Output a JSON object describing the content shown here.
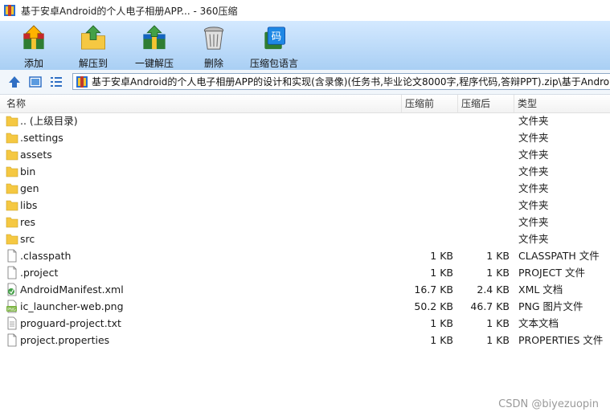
{
  "window": {
    "title": "基于安卓Android的个人电子相册APP... - 360压缩"
  },
  "toolbar": {
    "items": [
      {
        "label": "添加",
        "icon": "add-archive-icon"
      },
      {
        "label": "解压到",
        "icon": "extract-to-icon"
      },
      {
        "label": "一键解压",
        "icon": "one-click-extract-icon"
      },
      {
        "label": "删除",
        "icon": "trash-icon"
      },
      {
        "label": "压缩包语言",
        "icon": "archive-language-icon"
      }
    ]
  },
  "nav": {
    "buttons": [
      "up-arrow-icon",
      "thumbnail-view-icon",
      "list-view-icon"
    ],
    "path": "基于安卓Android的个人电子相册APP的设计和实现(含录像)(任务书,毕业论文8000字,程序代码,答辩PPT).zip\\基于Android的个人电子相册APP的设计和实现"
  },
  "columns": {
    "name": "名称",
    "size": "压缩前",
    "packed": "压缩后",
    "type": "类型"
  },
  "files": [
    {
      "name": ".. (上级目录)",
      "size": "",
      "packed": "",
      "type": "文件夹",
      "icon": "folder-icon"
    },
    {
      "name": ".settings",
      "size": "",
      "packed": "",
      "type": "文件夹",
      "icon": "folder-icon"
    },
    {
      "name": "assets",
      "size": "",
      "packed": "",
      "type": "文件夹",
      "icon": "folder-icon"
    },
    {
      "name": "bin",
      "size": "",
      "packed": "",
      "type": "文件夹",
      "icon": "folder-icon"
    },
    {
      "name": "gen",
      "size": "",
      "packed": "",
      "type": "文件夹",
      "icon": "folder-icon"
    },
    {
      "name": "libs",
      "size": "",
      "packed": "",
      "type": "文件夹",
      "icon": "folder-icon"
    },
    {
      "name": "res",
      "size": "",
      "packed": "",
      "type": "文件夹",
      "icon": "folder-icon"
    },
    {
      "name": "src",
      "size": "",
      "packed": "",
      "type": "文件夹",
      "icon": "folder-icon"
    },
    {
      "name": ".classpath",
      "size": "1 KB",
      "packed": "1 KB",
      "type": "CLASSPATH 文件",
      "icon": "blank-file-icon"
    },
    {
      "name": ".project",
      "size": "1 KB",
      "packed": "1 KB",
      "type": "PROJECT 文件",
      "icon": "blank-file-icon"
    },
    {
      "name": "AndroidManifest.xml",
      "size": "16.7 KB",
      "packed": "2.4 KB",
      "type": "XML 文档",
      "icon": "xml-file-icon"
    },
    {
      "name": "ic_launcher-web.png",
      "size": "50.2 KB",
      "packed": "46.7 KB",
      "type": "PNG 图片文件",
      "icon": "png-file-icon"
    },
    {
      "name": "proguard-project.txt",
      "size": "1 KB",
      "packed": "1 KB",
      "type": "文本文档",
      "icon": "text-file-icon"
    },
    {
      "name": "project.properties",
      "size": "1 KB",
      "packed": "1 KB",
      "type": "PROPERTIES 文件",
      "icon": "blank-file-icon"
    }
  ],
  "watermark": "CSDN @biyezuopin",
  "colors": {
    "toolbar_top": "#d4e9ff",
    "toolbar_bottom": "#a9cff4",
    "folder": "#f5c842",
    "accent": "#2f6fc4"
  }
}
